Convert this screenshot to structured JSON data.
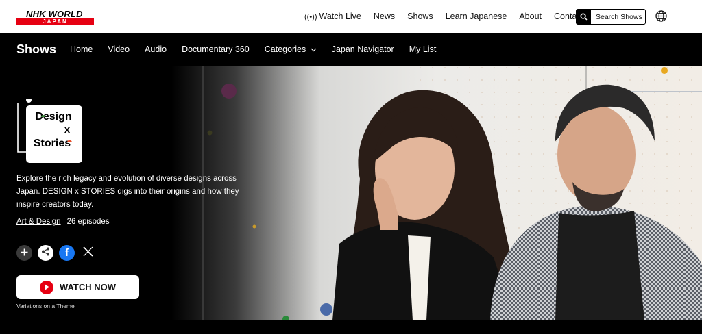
{
  "brand": {
    "line1": "NHK WORLD",
    "line2": "JAPAN"
  },
  "topnav": {
    "watch_live": "Watch Live",
    "news": "News",
    "shows": "Shows",
    "learn_japanese": "Learn Japanese",
    "about": "About",
    "contact": "Contact",
    "search_label": "Search Shows"
  },
  "subnav": {
    "title": "Shows",
    "items": [
      "Home",
      "Video",
      "Audio",
      "Documentary 360",
      "Categories",
      "Japan Navigator",
      "My List"
    ]
  },
  "show": {
    "logo_line1": "Design",
    "logo_line2": "x",
    "logo_line3": "Stories",
    "description": "Explore the rich legacy and evolution of diverse designs across Japan. DESIGN x STORIES digs into their origins and how they inspire creators today.",
    "genre": "Art & Design",
    "episodes": "26 episodes",
    "watch_label": "WATCH NOW",
    "theme_text": "Variations on a Theme"
  },
  "colors": {
    "brand_red": "#e60012",
    "facebook": "#1877f2"
  },
  "icons": [
    "broadcast-icon",
    "search-icon",
    "globe-icon",
    "plus-icon",
    "share-icon",
    "facebook-icon",
    "x-icon",
    "play-icon",
    "chevron-down-icon"
  ]
}
